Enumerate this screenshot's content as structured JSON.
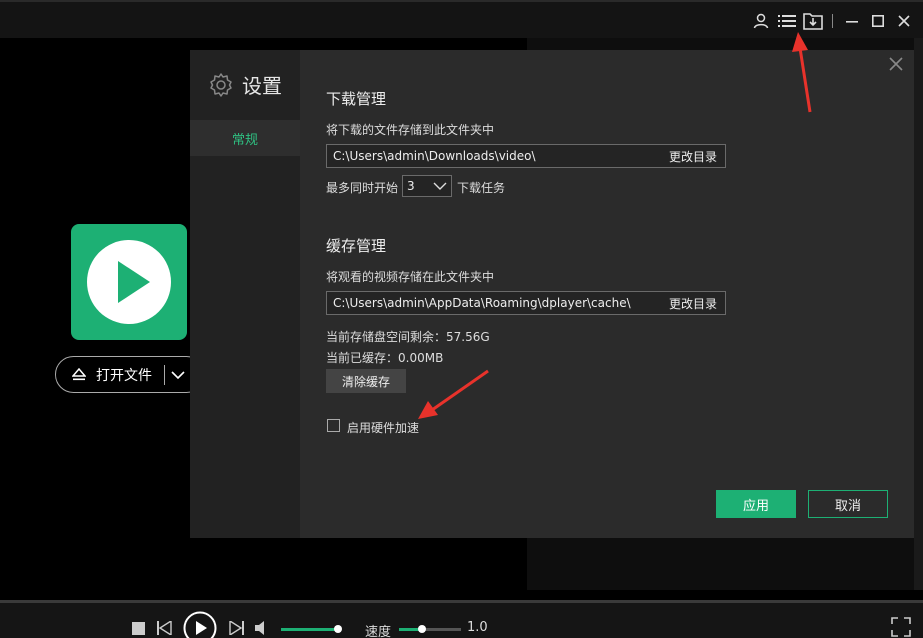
{
  "titlebar": {
    "icons": [
      "user-icon",
      "list-icon",
      "download-folder-icon",
      "minimize-icon",
      "maximize-icon",
      "close-icon"
    ]
  },
  "player": {
    "open_file_label": "打开文件"
  },
  "settings": {
    "title": "设置",
    "side_items": [
      {
        "label": "常规",
        "active": true
      }
    ],
    "download": {
      "title": "下载管理",
      "path_label": "将下载的文件存储到此文件夹中",
      "path_value": "C:\\Users\\admin\\Downloads\\video\\",
      "change_label": "更改目录",
      "concurrent_prefix": "最多同时开始",
      "concurrent_value": "3",
      "concurrent_suffix": "下载任务"
    },
    "cache": {
      "title": "缓存管理",
      "path_label": "将观看的视频存储在此文件夹中",
      "path_value": "C:\\Users\\admin\\AppData\\Roaming\\dplayer\\cache\\",
      "change_label": "更改目录",
      "free_space": "当前存储盘空间剩余：57.56G",
      "cached": "当前已缓存：0.00MB",
      "clear_label": "清除缓存"
    },
    "hw_accel": {
      "label": "启用硬件加速",
      "checked": false
    },
    "ok_label": "应用",
    "cancel_label": "取消"
  },
  "bottom": {
    "speed_label": "速度",
    "speed_value": "1.0",
    "volume_fraction": 0.95,
    "speed_fraction": 0.37
  },
  "colors": {
    "accent": "#1db074",
    "annotation": "#e8322b"
  }
}
